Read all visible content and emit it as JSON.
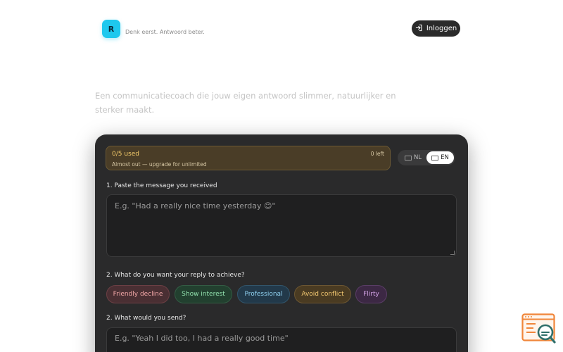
{
  "header": {
    "logo_letter": "R",
    "tagline": "Denk eerst. Antwoord beter.",
    "login_label": "Inloggen"
  },
  "hero": {
    "text": "Een communicatiecoach die jouw eigen antwoord slimmer, natuurlijker en sterker maakt."
  },
  "usage": {
    "count": "0/5 used",
    "left": "0 left",
    "note": "Almost out — upgrade for unlimited"
  },
  "language": {
    "nl": "NL",
    "en": "EN",
    "selected": "EN"
  },
  "form": {
    "step1_label": "1. Paste the message you received",
    "step1_placeholder": "E.g. \"Had a really nice time yesterday 😊\"",
    "step2_label": "2. What do you want your reply to achieve?",
    "goals": [
      "Friendly decline",
      "Show interest",
      "Professional",
      "Avoid conflict",
      "Flirty"
    ],
    "step3_label": "2. What would you send?",
    "step3_placeholder": "E.g. \"Yeah I did too, I had a really good time\""
  },
  "colors": {
    "brand_accent": "#1ec8ee",
    "card_bg": "#2a2a2b",
    "usage_bg": "#4a3d27",
    "usage_text": "#f1c96a"
  },
  "icons": {
    "login": "login-icon",
    "widget": "search-chat-widget-icon"
  }
}
